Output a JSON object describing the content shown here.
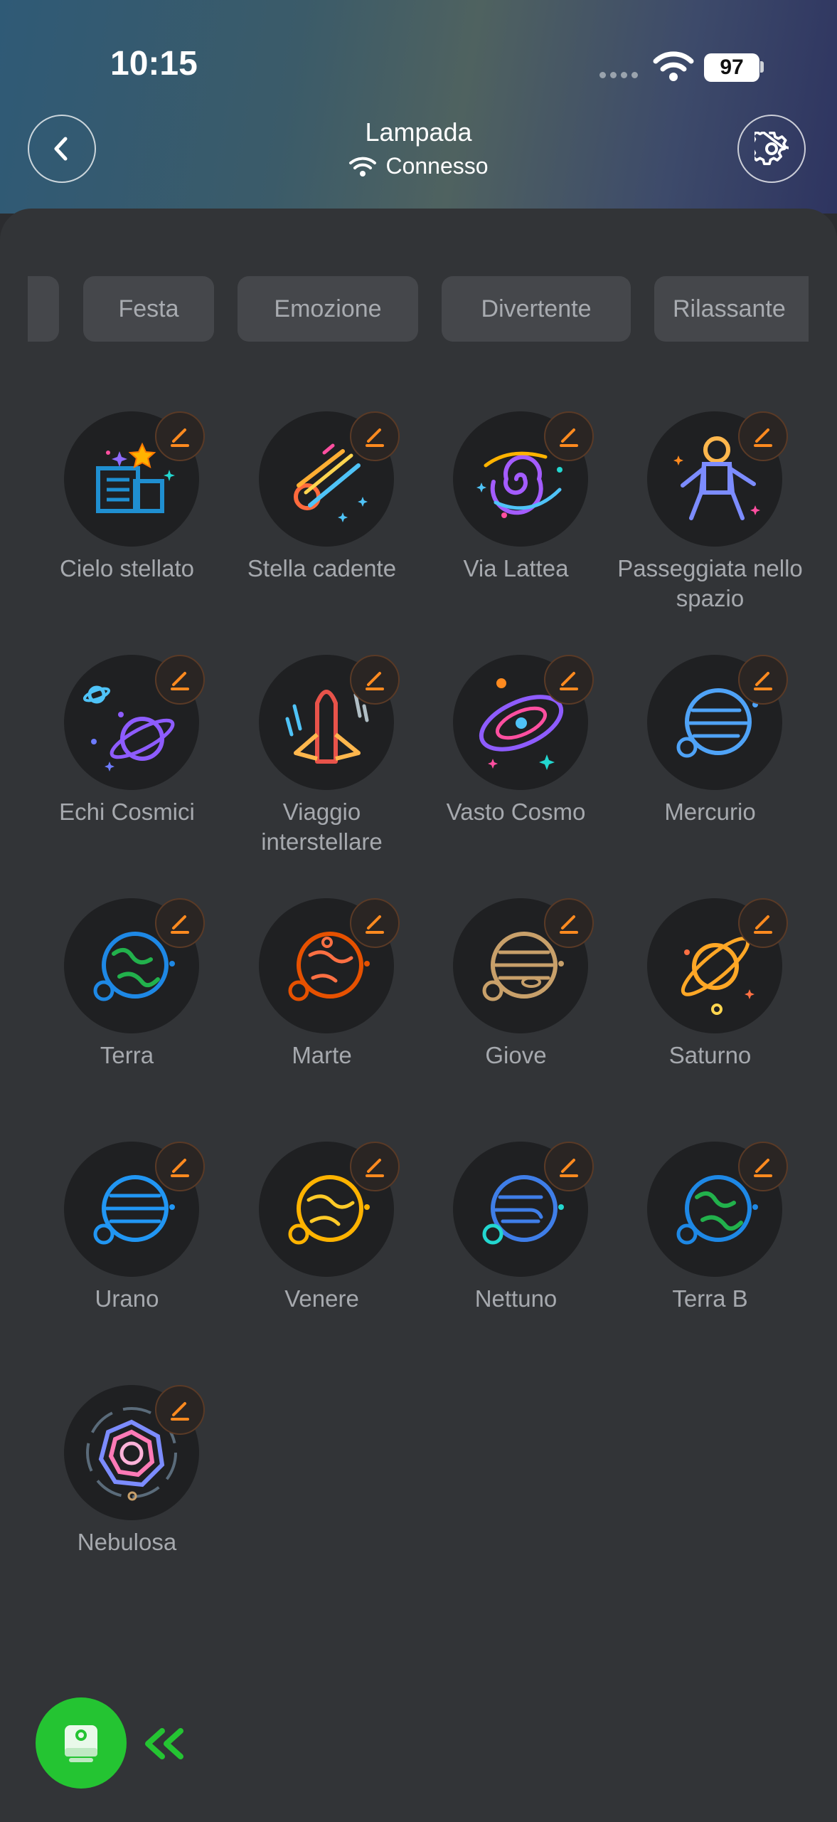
{
  "status_bar": {
    "time": "10:15",
    "battery": "97"
  },
  "header": {
    "title": "Lampada",
    "connection": "Connesso"
  },
  "tabs": [
    "",
    "Festa",
    "Emozione",
    "Divertente",
    "Rilassante"
  ],
  "scenes": [
    {
      "label": "Cielo stellato",
      "icon": "starry-city-icon"
    },
    {
      "label": "Stella cadente",
      "icon": "comet-icon"
    },
    {
      "label": "Via Lattea",
      "icon": "galaxy-spiral-icon"
    },
    {
      "label": "Passeggiata nello spazio",
      "icon": "astronaut-icon"
    },
    {
      "label": "Echi Cosmici",
      "icon": "ringed-planets-icon"
    },
    {
      "label": "Viaggio interstellare",
      "icon": "rocket-icon"
    },
    {
      "label": "Vasto Cosmo",
      "icon": "galaxy-icon"
    },
    {
      "label": "Mercurio",
      "icon": "planet-mercury-icon"
    },
    {
      "label": "Terra",
      "icon": "planet-earth-icon"
    },
    {
      "label": "Marte",
      "icon": "planet-mars-icon"
    },
    {
      "label": "Giove",
      "icon": "planet-jupiter-icon"
    },
    {
      "label": "Saturno",
      "icon": "planet-saturn-icon"
    },
    {
      "label": "Urano",
      "icon": "planet-uranus-icon"
    },
    {
      "label": "Venere",
      "icon": "planet-venus-icon"
    },
    {
      "label": "Nettuno",
      "icon": "planet-neptune-icon"
    },
    {
      "label": "Terra B",
      "icon": "planet-earth-b-icon"
    },
    {
      "label": "Nebulosa",
      "icon": "nebula-icon"
    }
  ],
  "colors": {
    "accent": "#ff8a1f",
    "fab": "#24c432"
  }
}
